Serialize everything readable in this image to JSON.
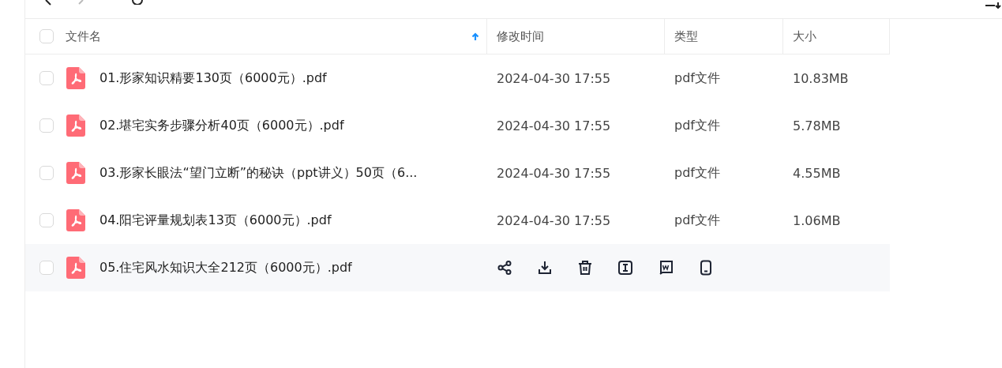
{
  "table": {
    "columns": [
      {
        "label": "文件名",
        "sorted": true
      },
      {
        "label": "修改时间",
        "sorted": false
      },
      {
        "label": "类型",
        "sorted": false
      },
      {
        "label": "大小",
        "sorted": false
      }
    ],
    "select_all": {
      "checked": false
    },
    "rows": [
      {
        "name": "01.形家知识精要130页（6000元）.pdf",
        "modified": "2024-04-30 17:55",
        "type": "pdf文件",
        "size": "10.83MB",
        "checked": false,
        "hovered": false
      },
      {
        "name": "02.堪宅实务步骤分析40页（6000元）.pdf",
        "modified": "2024-04-30 17:55",
        "type": "pdf文件",
        "size": "5.78MB",
        "checked": false,
        "hovered": false
      },
      {
        "name": "03.形家长眼法“望门立断”的秘诀（ppt讲义）50页（6...",
        "modified": "2024-04-30 17:55",
        "type": "pdf文件",
        "size": "4.55MB",
        "checked": false,
        "hovered": false
      },
      {
        "name": "04.阳宅评量规划表13页（6000元）.pdf",
        "modified": "2024-04-30 17:55",
        "type": "pdf文件",
        "size": "1.06MB",
        "checked": false,
        "hovered": false
      },
      {
        "name": "05.住宅风水知识大全212页（6000元）.pdf",
        "checked": false,
        "hovered": true
      }
    ]
  }
}
